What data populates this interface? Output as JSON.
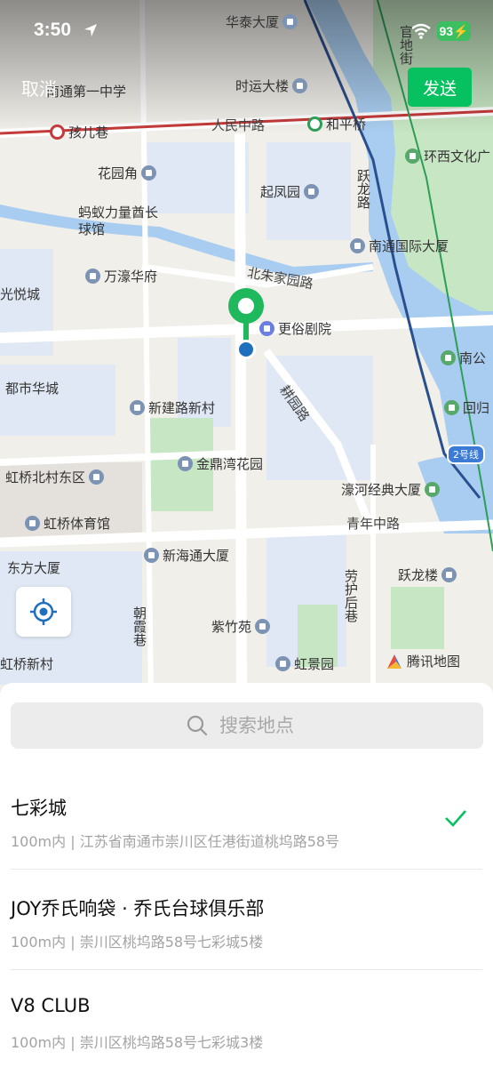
{
  "status_bar": {
    "time": "3:50",
    "battery": "93"
  },
  "header": {
    "cancel_label": "取消",
    "send_label": "发送"
  },
  "map": {
    "labels": {
      "huatai": "华泰大厦",
      "nantong_no1": "南通第一中学",
      "shiyun": "时运大楼",
      "haier_lane": "孩儿巷",
      "renmin_middle": "人民中路",
      "heping_bridge": "和平桥",
      "huanxi": "环西文化广",
      "huayuanjiao": "花园角",
      "qifengyuan": "起凤园",
      "yuelong_road": "跃龙路",
      "mayi": "蚂蚁力量酋长球馆",
      "nantong_intl": "南通国际大厦",
      "wanhao": "万濠华府",
      "beizhujiayuan": "北朱家园路",
      "guangyue": "光悦城",
      "gengsu": "更俗剧院",
      "nangong": "南公",
      "dushi": "都市华城",
      "xinjianlu": "新建路新村",
      "nuoyuan_road": "耕园路",
      "huixi": "回归",
      "line2": "2号线",
      "jindingwan": "金鼎湾花园",
      "hongqiao_north": "虹桥北村东区",
      "haohe": "濠河经典大厦",
      "hongqiao_gym": "虹桥体育馆",
      "qingnian": "青年中路",
      "dongfang": "东方大厦",
      "xinhaitong": "新海通大厦",
      "yuelong_lou": "跃龙楼",
      "laohu_lane": "劳护后巷",
      "chaoxia_lane": "朝霞巷",
      "zizhuyuan": "紫竹苑",
      "hongqiao_xincun": "虹桥新村",
      "hongjingyuan": "虹景园",
      "guandi": "官地街",
      "brand": "腾讯地图"
    }
  },
  "search": {
    "placeholder": "搜索地点"
  },
  "results": [
    {
      "name": "七彩城",
      "address": "100m内 | 江苏省南通市崇川区任港街道桃坞路58号",
      "selected": true
    },
    {
      "name": "JOY乔氏响袋 · 乔氏台球俱乐部",
      "address": "100m内 | 崇川区桃坞路58号七彩城5楼",
      "selected": false
    },
    {
      "name": "V8 CLUB",
      "address": "100m内 | 崇川区桃坞路58号七彩城3楼",
      "selected": false
    }
  ],
  "colors": {
    "accent": "#07c160",
    "pin": "#1fb85c",
    "water": "#a9cdf0",
    "metro_line1": "#c53a3a"
  }
}
